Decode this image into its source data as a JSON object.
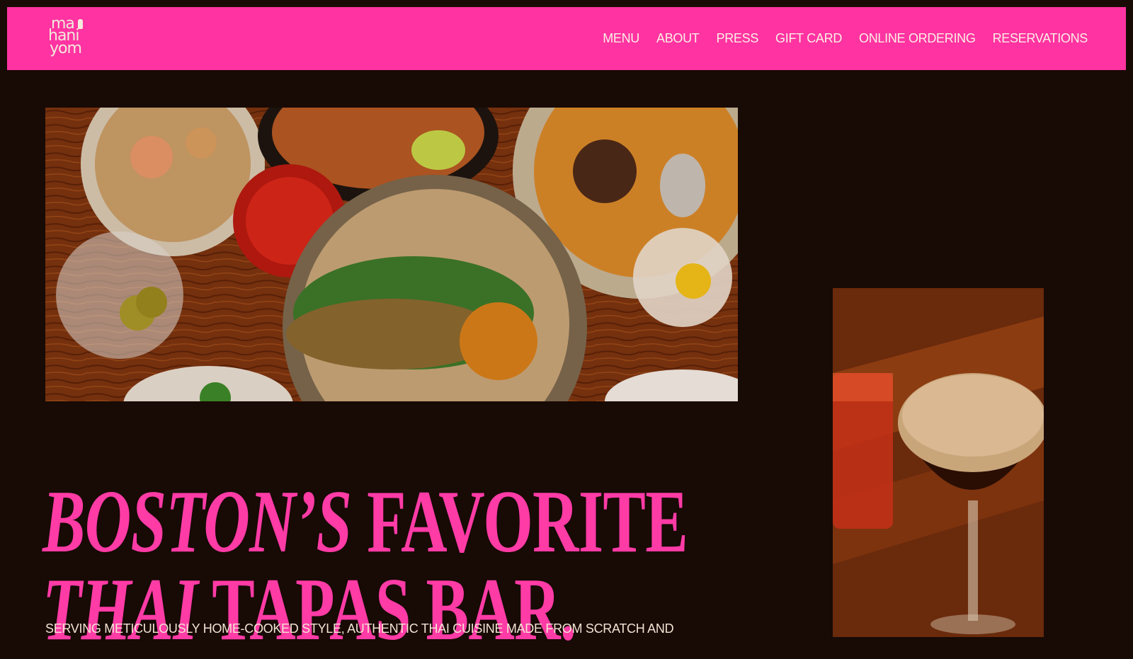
{
  "brand": {
    "logo_lines": [
      "ma",
      "hani",
      "yom"
    ],
    "accent": "#ff33a1",
    "background": "#180a05"
  },
  "nav": {
    "items": [
      {
        "label": "MENU"
      },
      {
        "label": "ABOUT"
      },
      {
        "label": "PRESS"
      },
      {
        "label": "GIFT CARD"
      },
      {
        "label": "ONLINE ORDERING"
      },
      {
        "label": "RESERVATIONS"
      }
    ]
  },
  "hero": {
    "headline_line1_italic": "BOSTON’S",
    "headline_line1_roman": "FAVORITE",
    "headline_line2_italic": "THAI",
    "headline_line2_roman": "TAPAS BAR.",
    "tagline": "SERVING METICULOUSLY HOME-COOKED STYLE, AUTHENTIC THAI CUISINE MADE FROM SCRATCH AND"
  }
}
